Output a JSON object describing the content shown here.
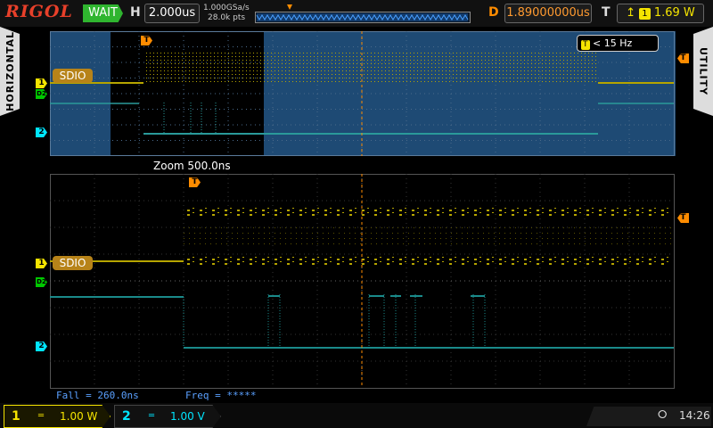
{
  "topbar": {
    "logo": "RIGOL",
    "status": "WAIT",
    "h_label": "H",
    "timebase": "2.000us",
    "sample_rate": "1.000GSa/s",
    "points": "28.0k pts",
    "d_label": "D",
    "delay": "1.89000000us",
    "t_label": "T",
    "trigger_channel": "1",
    "trigger_level": "1.69 W"
  },
  "sidetabs": {
    "left": "HORIZONTAL",
    "right": "UTILITY"
  },
  "overview": {
    "freq_badge": "< 15 Hz",
    "sdio_label": "SDIO",
    "ch1_marker": "1",
    "d2_marker": "D2",
    "ch2_marker": "2",
    "trig_marker": "T"
  },
  "zoom": {
    "title": "Zoom  500.0ns",
    "sdio_label": "SDIO",
    "ch1_marker": "1",
    "d2_marker": "D2",
    "ch2_marker": "2",
    "trig_marker": "T",
    "meas_fall": "Fall = 260.0ns",
    "meas_freq": "Freq = *****"
  },
  "bottombar": {
    "ch1_num": "1",
    "ch1_scale": "1.00 W",
    "ch2_num": "2",
    "ch2_scale": "1.00 V",
    "time": "14:26"
  },
  "colors": {
    "ch1": "#f5e400",
    "ch2": "#00e5ff",
    "digital": "#00c800",
    "accent": "#ff8c00",
    "sdio": "#b78319"
  }
}
